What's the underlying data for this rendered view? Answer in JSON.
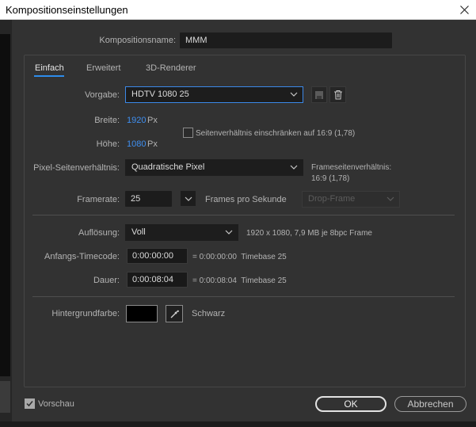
{
  "window": {
    "title": "Kompositionseinstellungen",
    "close_icon": "close-icon"
  },
  "composition_name": {
    "label": "Kompositionsname:",
    "value": "MMM"
  },
  "tabs": [
    {
      "label": "Einfach",
      "active": true
    },
    {
      "label": "Erweitert",
      "active": false
    },
    {
      "label": "3D-Renderer",
      "active": false
    }
  ],
  "basic": {
    "preset_label": "Vorgabe:",
    "preset_value": "HDTV 1080 25",
    "width_label": "Breite:",
    "width_value": "1920",
    "width_unit": "Px",
    "height_label": "Höhe:",
    "height_value": "1080",
    "height_unit": "Px",
    "lock_aspect_label": "Seitenverhältnis einschränken auf 16:9 (1,78)",
    "lock_aspect_checked": false,
    "par_label": "Pixel-Seitenverhältnis:",
    "par_value": "Quadratische Pixel",
    "frame_aspect_label": "Frameseitenverhältnis:",
    "frame_aspect_value": "16:9 (1,78)",
    "framerate_label": "Framerate:",
    "framerate_value": "25",
    "framerate_unit": "Frames pro Sekunde",
    "dropframe_value": "Drop-Frame",
    "resolution_label": "Auflösung:",
    "resolution_value": "Voll",
    "resolution_info": "1920 x 1080, 7,9 MB je 8bpc Frame",
    "start_tc_label": "Anfangs-Timecode:",
    "start_tc_value": "0:00:00:00",
    "start_tc_info": "= 0:00:00:00  Timebase 25",
    "duration_label": "Dauer:",
    "duration_value": "0:00:08:04",
    "duration_info": "= 0:00:08:04  Timebase 25",
    "bgcolor_label": "Hintergrundfarbe:",
    "bgcolor_name": "Schwarz",
    "bgcolor_value": "#000000"
  },
  "footer": {
    "preview_label": "Vorschau",
    "preview_checked": true,
    "ok_label": "OK",
    "cancel_label": "Abbrechen"
  },
  "colors": {
    "accent": "#2d8ceb",
    "value_blue": "#3f8ff0",
    "panel_bg": "#323232"
  }
}
